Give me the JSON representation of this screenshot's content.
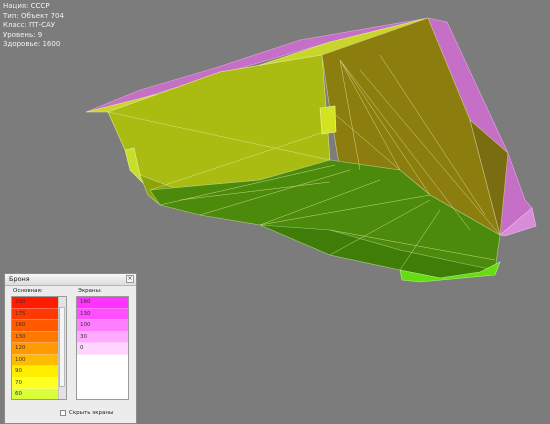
{
  "vehicle_info": {
    "nation": "Нация: СССР",
    "type": "Тип: Объект 704",
    "class": "Класс: ПТ-САУ",
    "tier": "Уровень: 9",
    "health": "Здоровье: 1600"
  },
  "armor_panel": {
    "title": "Броня",
    "close_icon": "close-icon",
    "main_label": "Основная:",
    "screens_label": "Экраны:",
    "main_armor": [
      {
        "value": "200",
        "color": "#ff1c00"
      },
      {
        "value": "175",
        "color": "#ff3a00"
      },
      {
        "value": "160",
        "color": "#ff5a00"
      },
      {
        "value": "130",
        "color": "#ff7800"
      },
      {
        "value": "120",
        "color": "#ff9a00"
      },
      {
        "value": "100",
        "color": "#ffbb00"
      },
      {
        "value": "90",
        "color": "#ffee00"
      },
      {
        "value": "70",
        "color": "#ffff20"
      },
      {
        "value": "60",
        "color": "#d8ff3a"
      }
    ],
    "screens": [
      {
        "value": "160",
        "color": "#ff32ff"
      },
      {
        "value": "130",
        "color": "#ff4fff"
      },
      {
        "value": "100",
        "color": "#ff7dff"
      },
      {
        "value": "30",
        "color": "#ffaaff"
      },
      {
        "value": "0",
        "color": "#ffd4ff"
      }
    ],
    "hide_screens_label": "Скрыть экраны"
  }
}
